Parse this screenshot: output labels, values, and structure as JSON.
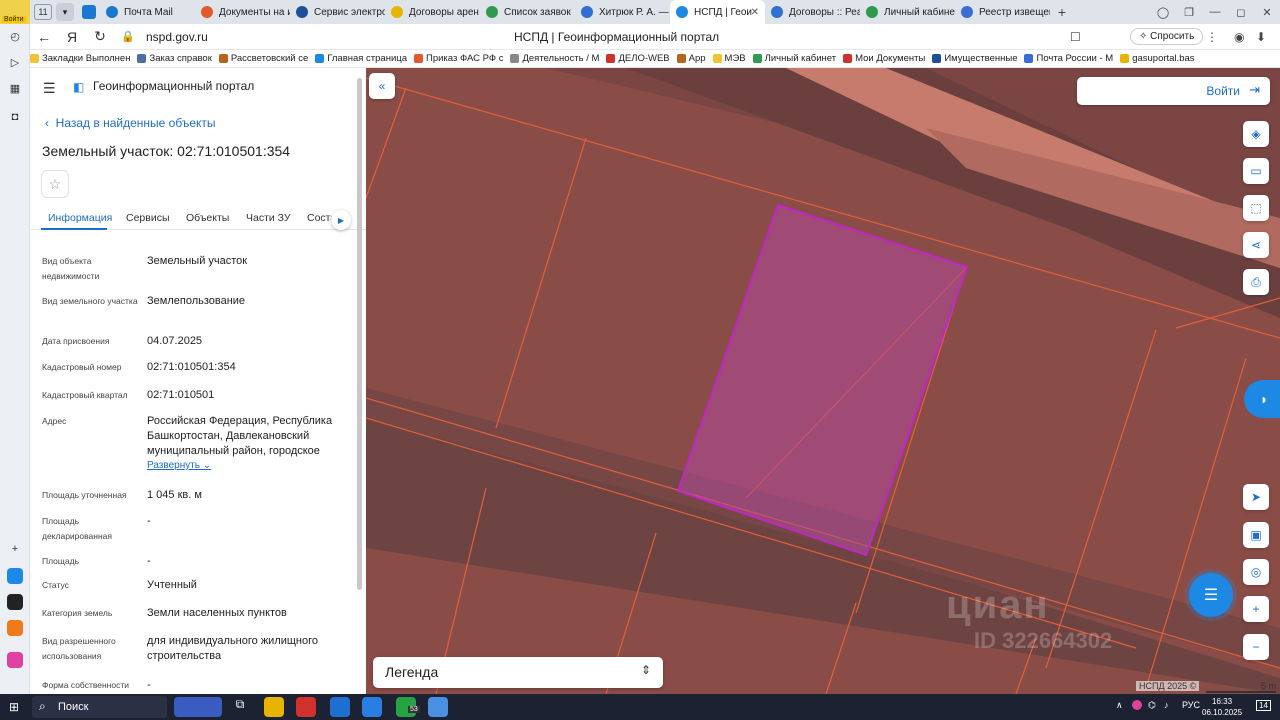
{
  "browser": {
    "tab_counter": "11",
    "tabs": [
      {
        "label": "Почта Mail",
        "color": "#1b78d0"
      },
      {
        "label": "Документы на и",
        "color": "#e05a2b"
      },
      {
        "label": "Сервис электро",
        "color": "#1e4f9a"
      },
      {
        "label": "Договоры арен",
        "color": "#e8b400"
      },
      {
        "label": "Список заявок",
        "color": "#2d9a4f"
      },
      {
        "label": "Хитрюк Р. А. —",
        "color": "#2f6fd6"
      },
      {
        "label": "НСПД | Геои",
        "color": "#1e88e5",
        "active": true
      },
      {
        "label": "Договоры :: Реа",
        "color": "#2f6fd6"
      },
      {
        "label": "Личный кабинет",
        "color": "#2d9a4f"
      },
      {
        "label": "Реестр извещен",
        "color": "#3b6cd4"
      }
    ],
    "url": "nspd.gov.ru",
    "page_title": "НСПД | Геоинформационный портал",
    "ask_label": "Спросить",
    "login_badge": "Войти",
    "bookmarks": [
      {
        "label": "Закладки Выполнен",
        "color": "#f1c232"
      },
      {
        "label": "Заказ справок",
        "color": "#4a6fa5"
      },
      {
        "label": "Рассветовский се",
        "color": "#b5651d"
      },
      {
        "label": "Главная страница",
        "color": "#1e88e5"
      },
      {
        "label": "Приказ ФАС РФ с",
        "color": "#e05a2b"
      },
      {
        "label": "Деятельность / М",
        "color": "#888888"
      },
      {
        "label": "ДЕЛО-WEB",
        "color": "#d0312d"
      },
      {
        "label": "App",
        "color": "#b5651d"
      },
      {
        "label": "МЭВ",
        "color": "#f1c232"
      },
      {
        "label": "Личный кабинет",
        "color": "#2d9a4f"
      },
      {
        "label": "Мои Документы",
        "color": "#d0312d"
      },
      {
        "label": "Имущественные",
        "color": "#1e4f9a"
      },
      {
        "label": "Почта России - М",
        "color": "#3b6cd4"
      },
      {
        "label": "gasuportal.bas",
        "color": "#e8b400"
      }
    ]
  },
  "portal": {
    "name": "Геоинформационный портал",
    "back_link": "Назад в найденные объекты",
    "object_title": "Земельный участок: 02:71:010501:354",
    "tabs": [
      "Информация",
      "Сервисы",
      "Объекты",
      "Части ЗУ",
      "Соста"
    ],
    "expand_label": "Развернуть",
    "fields": [
      {
        "label": "Вид объекта недвижимости",
        "value": "Земельный участок"
      },
      {
        "label": "Вид земельного участка",
        "value": "Землепользование"
      },
      {
        "label": "Дата присвоения",
        "value": "04.07.2025"
      },
      {
        "label": "Кадастровый номер",
        "value": "02:71:010501:354"
      },
      {
        "label": "Кадастровый квартал",
        "value": "02:71:010501"
      },
      {
        "label": "Адрес",
        "value": "Российская Федерация, Республика Башкортостан, Давлекановский муниципальный район, городское"
      },
      {
        "label": "Площадь уточненная",
        "value": "1 045 кв. м"
      },
      {
        "label": "Площадь декларированная",
        "value": "-"
      },
      {
        "label": "Площадь",
        "value": "-"
      },
      {
        "label": "Статус",
        "value": "Учтенный"
      },
      {
        "label": "Категория земель",
        "value": "Земли населенных пунктов"
      },
      {
        "label": "Вид разрешенного использования",
        "value": "для индивидуального жилищного строительства"
      },
      {
        "label": "Форма собственности",
        "value": "-"
      }
    ]
  },
  "map": {
    "login_label": "Войти",
    "legend_label": "Легенда",
    "watermark": "циан",
    "watermark_id": "ID 322664302",
    "copyright": "НСПД 2025 ©",
    "scale_label": "5 m",
    "parcel_color": "#c026c8",
    "boundary_color": "#e0603a"
  },
  "taskbar": {
    "search_label": "Поиск",
    "lang": "РУС",
    "time": "16:33",
    "date": "06.10.2025",
    "whatsapp_badge": "53",
    "notif_count": "14"
  }
}
